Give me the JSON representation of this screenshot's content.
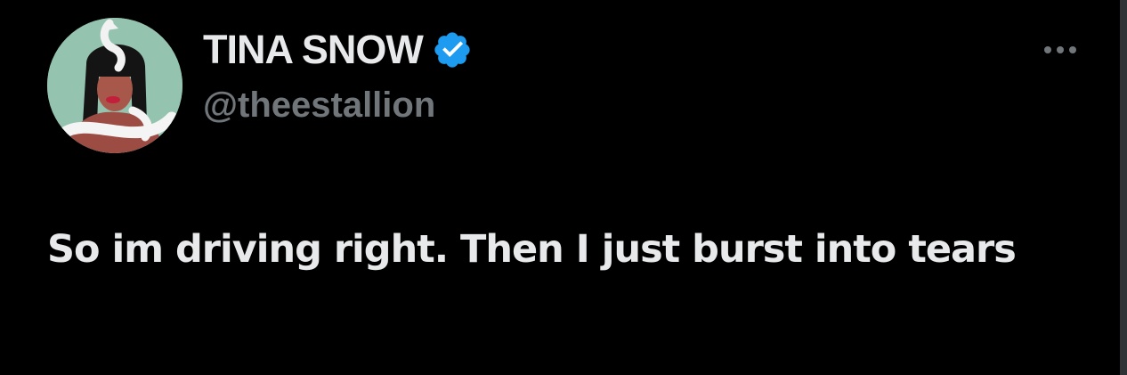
{
  "user": {
    "display_name": "TINA SNOW",
    "handle": "@theestallion",
    "verified": true,
    "avatar_icon": "profile-avatar"
  },
  "menu": {
    "icon": "more-options-icon"
  },
  "tweet": {
    "text": "So im driving right. Then I just burst into tears"
  },
  "colors": {
    "background": "#000000",
    "primary_text": "#e7e9ea",
    "secondary_text": "#71767b",
    "verified_badge": "#1d9bf0"
  }
}
